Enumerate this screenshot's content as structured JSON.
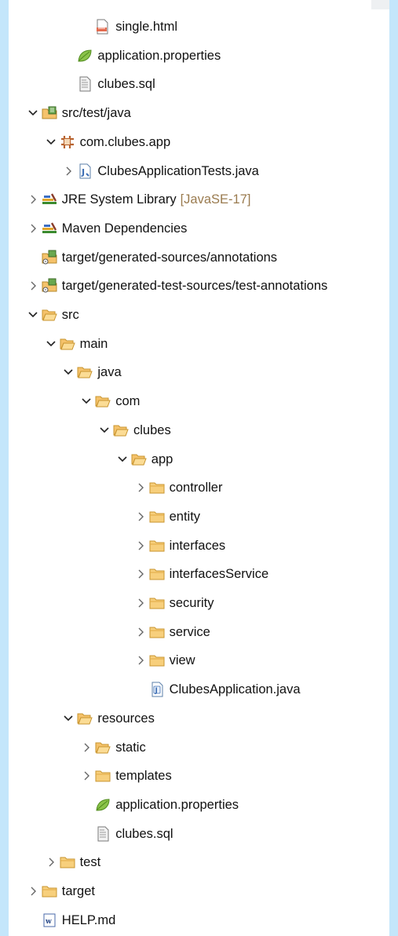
{
  "tree": [
    {
      "level": 4,
      "twisty": "none",
      "icon": "html-file-icon",
      "label": "single.html"
    },
    {
      "level": 3,
      "twisty": "none",
      "icon": "spring-leaf-icon",
      "label": "application.properties"
    },
    {
      "level": 3,
      "twisty": "none",
      "icon": "sql-file-icon",
      "label": "clubes.sql"
    },
    {
      "level": 1,
      "twisty": "expanded",
      "icon": "source-folder-icon",
      "label": "src/test/java"
    },
    {
      "level": 2,
      "twisty": "expanded",
      "icon": "package-icon",
      "label": "com.clubes.app"
    },
    {
      "level": 3,
      "twisty": "collapsed",
      "icon": "java-test-file-icon",
      "label": "ClubesApplicationTests.java"
    },
    {
      "level": 1,
      "twisty": "collapsed",
      "icon": "library-icon",
      "label": "JRE System Library",
      "decoration": "[JavaSE-17]"
    },
    {
      "level": 1,
      "twisty": "collapsed",
      "icon": "library-icon",
      "label": "Maven Dependencies"
    },
    {
      "level": 1,
      "twisty": "none",
      "icon": "generated-source-folder-icon",
      "label": "target/generated-sources/annotations"
    },
    {
      "level": 1,
      "twisty": "collapsed",
      "icon": "generated-source-folder-icon",
      "label": "target/generated-test-sources/test-annotations"
    },
    {
      "level": 1,
      "twisty": "expanded",
      "icon": "folder-open-icon",
      "label": "src"
    },
    {
      "level": 2,
      "twisty": "expanded",
      "icon": "folder-open-icon",
      "label": "main"
    },
    {
      "level": 3,
      "twisty": "expanded",
      "icon": "folder-open-icon",
      "label": "java"
    },
    {
      "level": 4,
      "twisty": "expanded",
      "icon": "folder-open-icon",
      "label": "com"
    },
    {
      "level": 5,
      "twisty": "expanded",
      "icon": "folder-open-icon",
      "label": "clubes"
    },
    {
      "level": 6,
      "twisty": "expanded",
      "icon": "folder-open-icon",
      "label": "app"
    },
    {
      "level": 7,
      "twisty": "collapsed",
      "icon": "folder-icon",
      "label": "controller"
    },
    {
      "level": 7,
      "twisty": "collapsed",
      "icon": "folder-icon",
      "label": "entity"
    },
    {
      "level": 7,
      "twisty": "collapsed",
      "icon": "folder-icon",
      "label": "interfaces"
    },
    {
      "level": 7,
      "twisty": "collapsed",
      "icon": "folder-icon",
      "label": "interfacesService"
    },
    {
      "level": 7,
      "twisty": "collapsed",
      "icon": "folder-icon",
      "label": "security"
    },
    {
      "level": 7,
      "twisty": "collapsed",
      "icon": "folder-icon",
      "label": "service"
    },
    {
      "level": 7,
      "twisty": "collapsed",
      "icon": "folder-icon",
      "label": "view"
    },
    {
      "level": 7,
      "twisty": "none",
      "icon": "java-file-icon",
      "label": "ClubesApplication.java"
    },
    {
      "level": 3,
      "twisty": "expanded",
      "icon": "folder-open-icon",
      "label": "resources"
    },
    {
      "level": 4,
      "twisty": "collapsed",
      "icon": "folder-open-icon",
      "label": "static"
    },
    {
      "level": 4,
      "twisty": "collapsed",
      "icon": "folder-icon",
      "label": "templates"
    },
    {
      "level": 4,
      "twisty": "none",
      "icon": "spring-leaf-icon",
      "label": "application.properties"
    },
    {
      "level": 4,
      "twisty": "none",
      "icon": "sql-file-icon",
      "label": "clubes.sql"
    },
    {
      "level": 2,
      "twisty": "collapsed",
      "icon": "folder-icon",
      "label": "test"
    },
    {
      "level": 1,
      "twisty": "collapsed",
      "icon": "folder-icon",
      "label": "target"
    },
    {
      "level": 1,
      "twisty": "none",
      "icon": "markdown-file-icon",
      "label": "HELP.md"
    }
  ]
}
